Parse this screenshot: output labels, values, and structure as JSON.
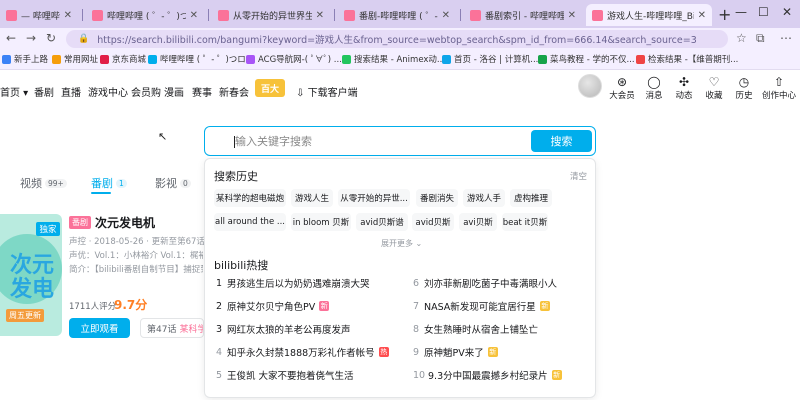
{
  "browser": {
    "tabs": [
      {
        "title": "— 哔哩哔哩弹幕视"
      },
      {
        "title": "哔哩哔哩 ( ゜- ゜)つロ 干杯"
      },
      {
        "title": "从零开始的异世界生活-哔哩"
      },
      {
        "title": "番剧-哔哩哔哩 ( ゜- ゜)つロ"
      },
      {
        "title": "番剧索引 - 哔哩哔哩 ( ゜- ゜"
      },
      {
        "title": "游戏人生-哔哩哔哩_Bilibili"
      }
    ],
    "new_tab": "+",
    "url": "https://search.bilibili.com/bangumi?keyword=游戏人生&from_source=webtop_search&spm_id_from=666.14&search_source=3",
    "bookmarks": [
      {
        "label": "新手上路",
        "color": "#3b82f6"
      },
      {
        "label": "常用网址",
        "color": "#f59e0b"
      },
      {
        "label": "京东商城",
        "color": "#e11d48"
      },
      {
        "label": "哔哩哔哩 ( ゜- ゜)つロ...",
        "color": "#00aeec"
      },
      {
        "label": "ACG导航网-( ﾟ∀ﾟ) ...",
        "color": "#a855f7"
      },
      {
        "label": "搜索结果 - Animex动...",
        "color": "#22c55e"
      },
      {
        "label": "首页 - 洛谷 | 计算机...",
        "color": "#0ea5e9"
      },
      {
        "label": "菜鸟教程 - 学的不仅...",
        "color": "#16a34a"
      },
      {
        "label": "检索结果 -【维普期刊...",
        "color": "#ef4444"
      }
    ]
  },
  "header": {
    "nav": [
      "首页",
      "番剧",
      "直播",
      "游戏中心",
      "会员购",
      "漫画",
      "赛事",
      "新春会"
    ],
    "highlight_badge": "百大",
    "download": "下载客户端",
    "right_icons": [
      {
        "label": "大会员",
        "icon": "vip-icon"
      },
      {
        "label": "消息",
        "icon": "message-icon"
      },
      {
        "label": "动态",
        "icon": "dynamic-icon"
      },
      {
        "label": "收藏",
        "icon": "favorite-icon"
      },
      {
        "label": "历史",
        "icon": "history-icon"
      },
      {
        "label": "创作中心",
        "icon": "upload-icon"
      }
    ]
  },
  "search": {
    "placeholder": "输入关键字搜索",
    "button": "搜索"
  },
  "results": {
    "tabs": [
      {
        "label": "视频",
        "count": "99+"
      },
      {
        "label": "番剧",
        "count": "1"
      },
      {
        "label": "影视",
        "count": "0"
      }
    ],
    "item": {
      "tag": "番剧",
      "exclusive": "独家",
      "title": "次元发电机",
      "meta1": "声控 · 2018-05-26 · 更新至第67话",
      "meta2": "声优：Vol.1：小林裕介 Vol.1：梶裕贵",
      "meta3": "简介：【bilibili番剧自制节目】捕捉到一",
      "rating_count": "1711人评分",
      "score": "9.7分",
      "watch": "立即观看",
      "episode_prefix": "第47话",
      "episode_name": "某科学的"
    }
  },
  "dropdown": {
    "history_title": "搜索历史",
    "clear": "清空",
    "history": [
      "某科学的超电磁炮",
      "游戏人生",
      "从零开始的异世...",
      "番剧消失",
      "游戏人手",
      "虚构推理",
      "all around the ...",
      "in bloom 贝斯",
      "avid贝斯谱",
      "avid贝斯",
      "avi贝斯",
      "beat it贝斯"
    ],
    "expand": "展开更多",
    "hot_title": "bilibili热搜",
    "hot": [
      {
        "rank": "1",
        "text": "男孩逃生后以为奶奶遇难崩溃大哭",
        "badge": ""
      },
      {
        "rank": "2",
        "text": "原神艾尔贝宁角色PV",
        "badge": "新",
        "badge_color": "#fb7299"
      },
      {
        "rank": "3",
        "text": "网红灰太狼的羊老公再度发声",
        "badge": ""
      },
      {
        "rank": "4",
        "text": "知乎永久封禁1888万彩礼作者帐号",
        "badge": "热",
        "badge_color": "#ff4d4f"
      },
      {
        "rank": "5",
        "text": "王俊凯 大家不要抱着侥气生活",
        "badge": ""
      },
      {
        "rank": "6",
        "text": "刘亦菲新剧吃菌子中毒满眼小人",
        "badge": ""
      },
      {
        "rank": "7",
        "text": "NASA新发现可能宜居行星",
        "badge": "新",
        "badge_color": "#f7c23a"
      },
      {
        "rank": "8",
        "text": "女生熟睡时从宿舍上铺坠亡",
        "badge": ""
      },
      {
        "rank": "9",
        "text": "原神魈PV来了",
        "badge": "新",
        "badge_color": "#f7c23a"
      },
      {
        "rank": "10",
        "text": "9.3分中国最震撼乡村纪录片",
        "badge": "新",
        "badge_color": "#f7c23a"
      }
    ]
  }
}
